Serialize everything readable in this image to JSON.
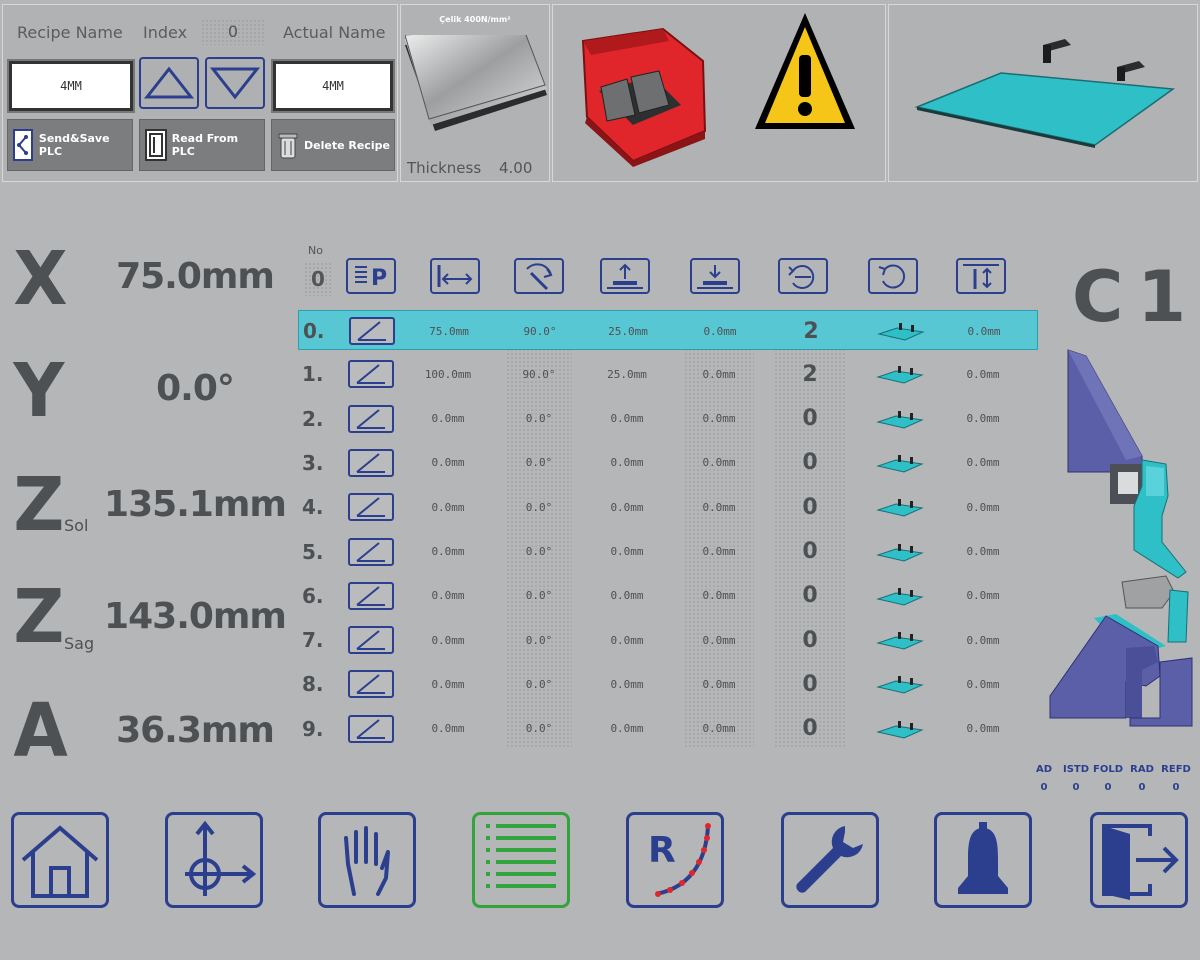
{
  "recipe": {
    "recipe_name_label": "Recipe Name",
    "index_label": "Index",
    "index_value": "0",
    "actual_name_label": "Actual Name",
    "recipe_name_value": "4MM",
    "actual_name_value": "4MM",
    "send_save_label": "Send&Save PLC",
    "read_plc_label": "Read From PLC",
    "delete_label": "Delete Recipe"
  },
  "material": {
    "name": "Çelik 400N/mm²",
    "thickness_label": "Thickness",
    "thickness_value": "4.00"
  },
  "axes": [
    {
      "letter": "X",
      "sub": "",
      "value": "75.0mm"
    },
    {
      "letter": "Y",
      "sub": "",
      "value": "0.0°"
    },
    {
      "letter": "Z",
      "sub": "Sol",
      "value": "135.1mm"
    },
    {
      "letter": "Z",
      "sub": "Sag",
      "value": "143.0mm"
    },
    {
      "letter": "A",
      "sub": "",
      "value": "36.3mm"
    }
  ],
  "table": {
    "no_label": "No",
    "no_value": "0",
    "rows": [
      {
        "no": "0.",
        "x": "75.0mm",
        "angle": "90.0°",
        "up": "25.0mm",
        "down": "0.0mm",
        "rot": "2",
        "last": "0.0mm"
      },
      {
        "no": "1.",
        "x": "100.0mm",
        "angle": "90.0°",
        "up": "25.0mm",
        "down": "0.0mm",
        "rot": "2",
        "last": "0.0mm"
      },
      {
        "no": "2.",
        "x": "0.0mm",
        "angle": "0.0°",
        "up": "0.0mm",
        "down": "0.0mm",
        "rot": "0",
        "last": "0.0mm"
      },
      {
        "no": "3.",
        "x": "0.0mm",
        "angle": "0.0°",
        "up": "0.0mm",
        "down": "0.0mm",
        "rot": "0",
        "last": "0.0mm"
      },
      {
        "no": "4.",
        "x": "0.0mm",
        "angle": "0.0°",
        "up": "0.0mm",
        "down": "0.0mm",
        "rot": "0",
        "last": "0.0mm"
      },
      {
        "no": "5.",
        "x": "0.0mm",
        "angle": "0.0°",
        "up": "0.0mm",
        "down": "0.0mm",
        "rot": "0",
        "last": "0.0mm"
      },
      {
        "no": "6.",
        "x": "0.0mm",
        "angle": "0.0°",
        "up": "0.0mm",
        "down": "0.0mm",
        "rot": "0",
        "last": "0.0mm"
      },
      {
        "no": "7.",
        "x": "0.0mm",
        "angle": "0.0°",
        "up": "0.0mm",
        "down": "0.0mm",
        "rot": "0",
        "last": "0.0mm"
      },
      {
        "no": "8.",
        "x": "0.0mm",
        "angle": "0.0°",
        "up": "0.0mm",
        "down": "0.0mm",
        "rot": "0",
        "last": "0.0mm"
      },
      {
        "no": "9.",
        "x": "0.0mm",
        "angle": "0.0°",
        "up": "0.0mm",
        "down": "0.0mm",
        "rot": "0",
        "last": "0.0mm"
      }
    ]
  },
  "program_code": "C1",
  "status": [
    {
      "label": "AD",
      "value": "0"
    },
    {
      "label": "ISTD",
      "value": "0"
    },
    {
      "label": "FOLD",
      "value": "0"
    },
    {
      "label": "RAD",
      "value": "0"
    },
    {
      "label": "REFD",
      "value": "0"
    }
  ],
  "colors": {
    "accent_blue": "#2c3f8f",
    "selected_row": "#58c7d4",
    "active_nav": "#33a33e",
    "sheet_teal": "#2fbfc7",
    "warning_yellow": "#f5c518",
    "pedal_red": "#e0262a"
  },
  "nav": [
    "home-icon",
    "axis-icon",
    "manual-hand-icon",
    "program-list-icon",
    "radius-icon",
    "wrench-icon",
    "bell-icon",
    "exit-icon"
  ]
}
